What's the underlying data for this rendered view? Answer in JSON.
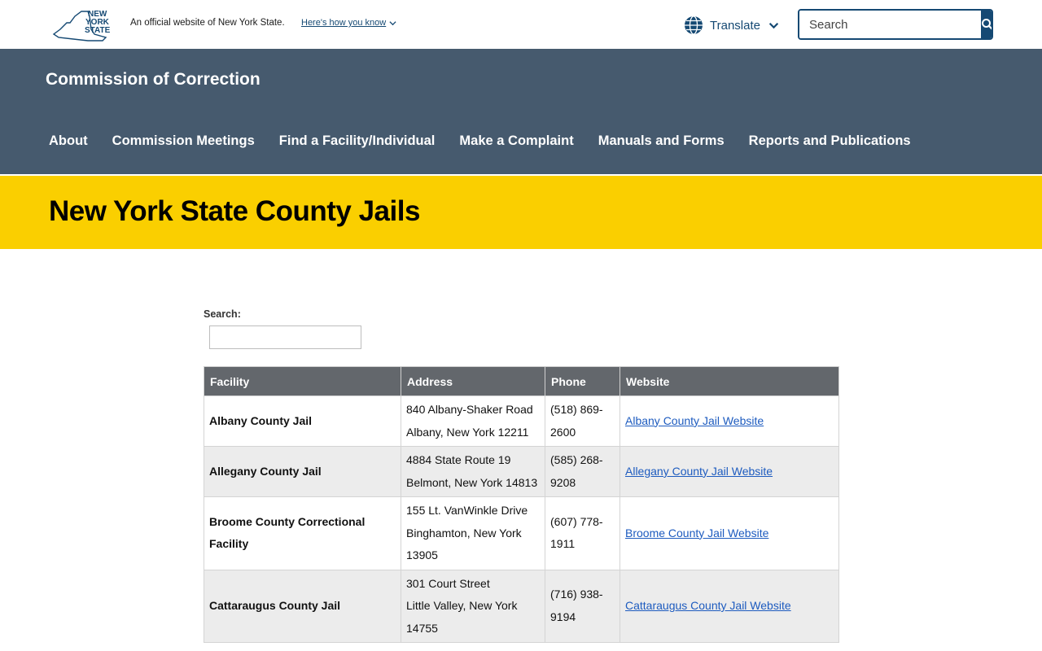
{
  "topbar": {
    "logo_text": "NEW YORK STATE",
    "official_text": "An official website of New York State.",
    "how_know": "Here's how you know",
    "translate_label": "Translate",
    "search_placeholder": "Search",
    "brand_color": "#154973"
  },
  "agency": {
    "title": "Commission of Correction",
    "nav": [
      {
        "label": "About"
      },
      {
        "label": "Commission Meetings"
      },
      {
        "label": "Find a Facility/Individual"
      },
      {
        "label": "Make a Complaint"
      },
      {
        "label": "Manuals and Forms"
      },
      {
        "label": "Reports and Publications"
      }
    ],
    "header_color": "#465a6e",
    "accent_color": "#facf00"
  },
  "page": {
    "title": "New York State County Jails",
    "search_label": "Search:"
  },
  "table": {
    "headers": [
      "Facility",
      "Address",
      "Phone",
      "Website"
    ],
    "rows": [
      {
        "facility": "Albany County Jail",
        "address1": "840 Albany-Shaker Road",
        "address2": "Albany, New York 12211",
        "phone": "(518) 869-2600",
        "website": "Albany County Jail Website"
      },
      {
        "facility": "Allegany County Jail",
        "address1": "4884 State Route 19",
        "address2": "Belmont, New York 14813",
        "phone": "(585) 268-9208",
        "website": "Allegany County Jail Website"
      },
      {
        "facility": "Broome County Correctional Facility",
        "address1": "155 Lt. VanWinkle Drive",
        "address2": "Binghamton, New York 13905",
        "phone": "(607) 778-1911",
        "website": "Broome County Jail Website"
      },
      {
        "facility": "Cattaraugus County Jail",
        "address1": "301 Court Street",
        "address2": "Little Valley, New York 14755",
        "phone": "(716) 938-9194",
        "website": "Cattaraugus County Jail Website"
      }
    ]
  }
}
